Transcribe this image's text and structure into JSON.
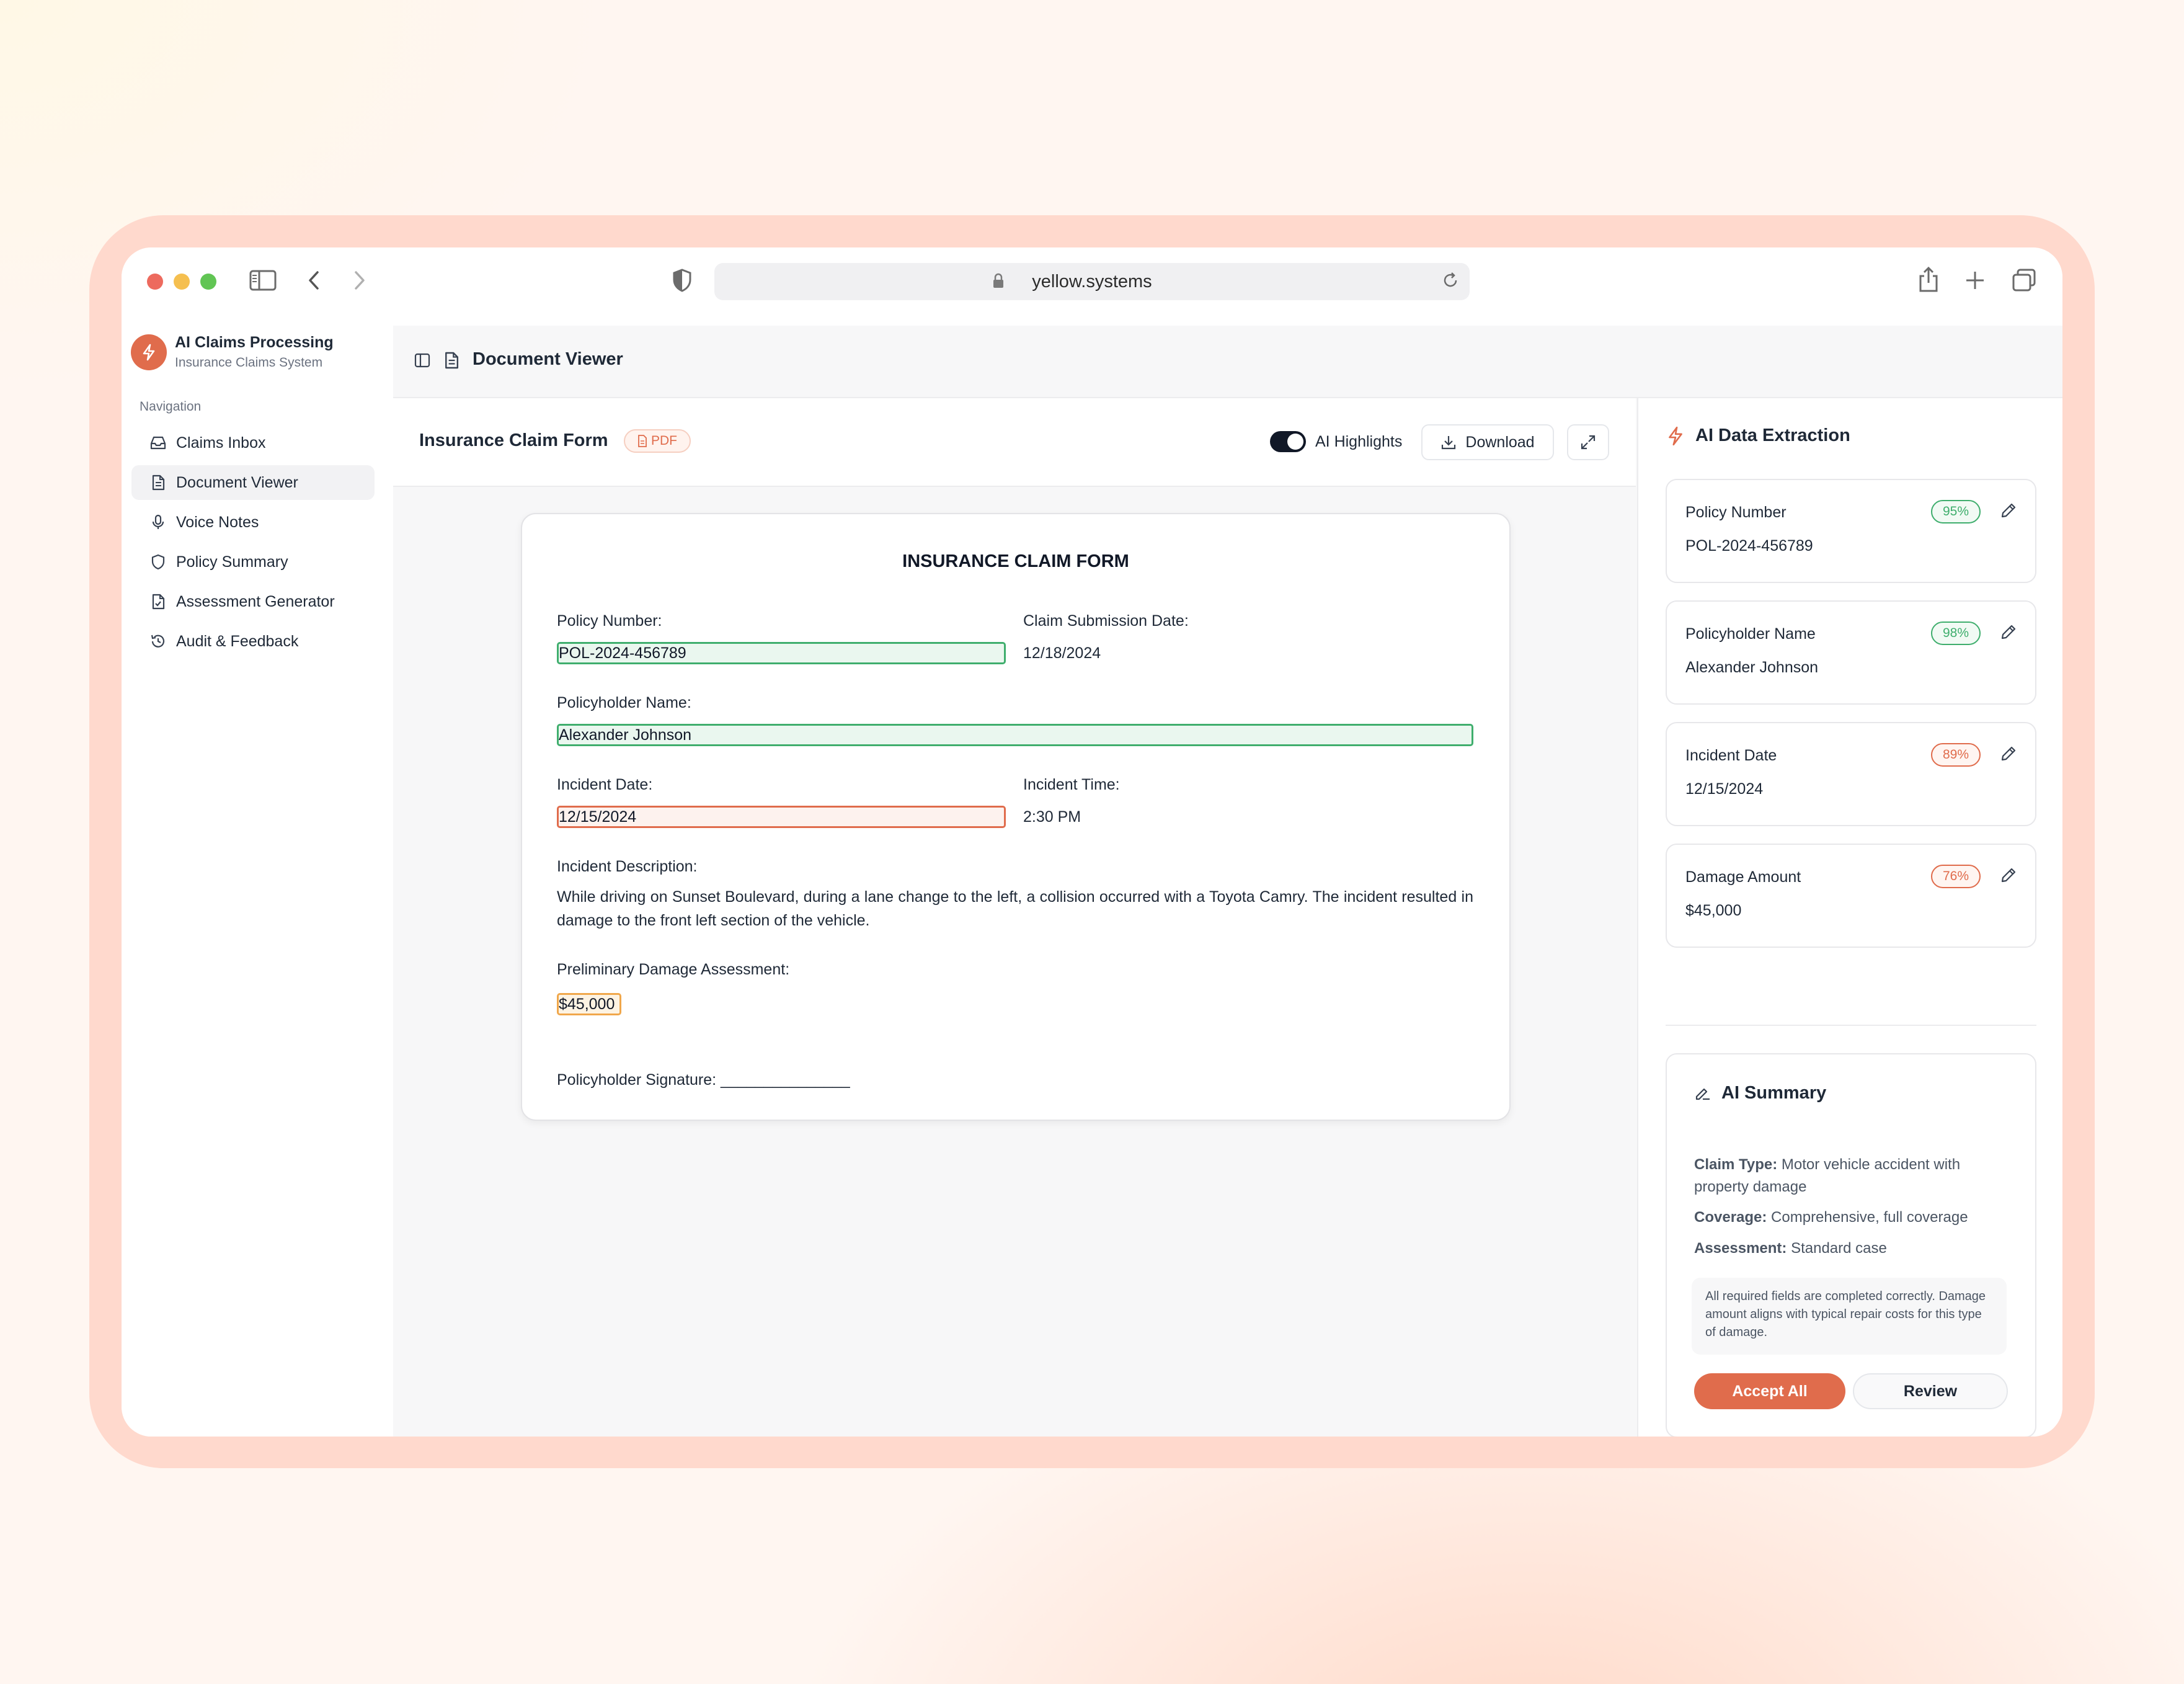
{
  "browser": {
    "url": "yellow.systems"
  },
  "app": {
    "title": "AI Claims Processing",
    "subtitle": "Insurance Claims System"
  },
  "sidebar": {
    "heading": "Navigation",
    "items": [
      {
        "label": "Claims Inbox",
        "icon": "inbox-icon"
      },
      {
        "label": "Document Viewer",
        "icon": "document-icon",
        "active": true
      },
      {
        "label": "Voice Notes",
        "icon": "microphone-icon"
      },
      {
        "label": "Policy Summary",
        "icon": "shield-icon"
      },
      {
        "label": "Assessment Generator",
        "icon": "document-check-icon"
      },
      {
        "label": "Audit & Feedback",
        "icon": "history-icon"
      }
    ]
  },
  "header": {
    "title": "Document Viewer"
  },
  "toolbar": {
    "doc_title": "Insurance Claim Form",
    "badge": "PDF",
    "ai_highlights_label": "AI Highlights",
    "ai_highlights_on": true,
    "download_label": "Download"
  },
  "form": {
    "title": "INSURANCE CLAIM FORM",
    "policy_number_label": "Policy Number:",
    "policy_number": "POL-2024-456789",
    "submission_date_label": "Claim Submission Date:",
    "submission_date": "12/18/2024",
    "policyholder_label": "Policyholder Name:",
    "policyholder": "Alexander Johnson",
    "incident_date_label": "Incident Date:",
    "incident_date": "12/15/2024",
    "incident_time_label": "Incident Time:",
    "incident_time": "2:30 PM",
    "description_label": "Incident Description:",
    "description": "While driving on Sunset Boulevard, during a lane change to the left, a collision occurred with a Toyota Camry. The incident resulted in damage to the front left section of the vehicle.",
    "damage_label": "Preliminary Damage Assessment:",
    "damage": "$45,000",
    "signature_label": "Policyholder Signature: _______________"
  },
  "extraction": {
    "title": "AI Data Extraction",
    "fields": [
      {
        "label": "Policy Number",
        "value": "POL-2024-456789",
        "confidence": "95%"
      },
      {
        "label": "Policyholder Name",
        "value": "Alexander Johnson",
        "confidence": "98%"
      },
      {
        "label": "Incident Date",
        "value": "12/15/2024",
        "confidence": "89%"
      },
      {
        "label": "Damage Amount",
        "value": "$45,000",
        "confidence": "76%"
      }
    ]
  },
  "summary": {
    "title": "AI Summary",
    "claim_type_key": "Claim Type:",
    "claim_type": "Motor vehicle accident with property damage",
    "coverage_key": "Coverage:",
    "coverage": "Comprehensive, full coverage",
    "assessment_key": "Assessment:",
    "assessment": "Standard case",
    "note": "All required fields are completed correctly. Damage amount aligns with typical repair costs for this type of damage.",
    "accept_label": "Accept All",
    "review_label": "Review"
  },
  "colors": {
    "accent": "#e06c4c",
    "high_confidence": "#3fae6d",
    "low_confidence": "#e06c4c",
    "highlight_orange": "#f0a74b"
  }
}
